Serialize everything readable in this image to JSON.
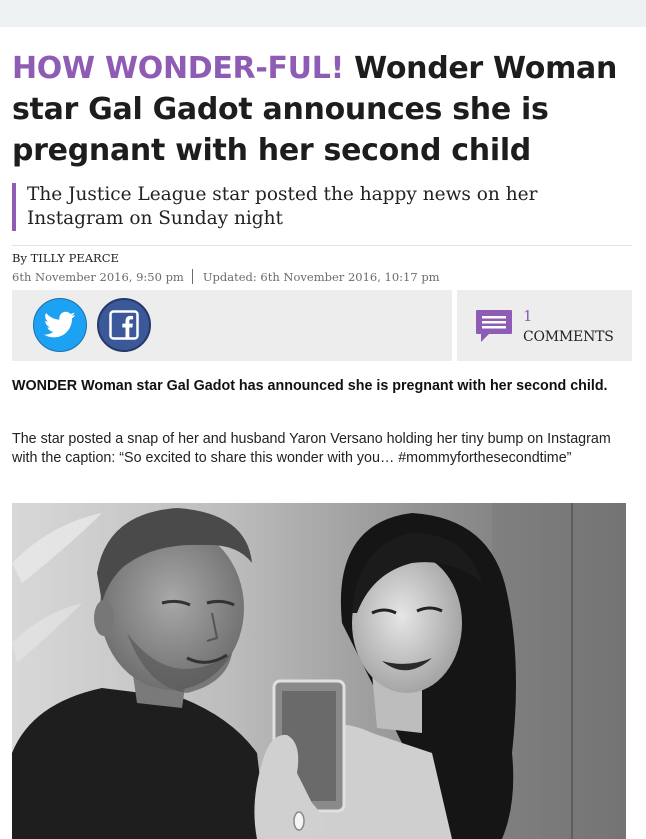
{
  "headline": {
    "kicker": "HOW WONDER-FUL!",
    "text": "Wonder Woman star Gal Gadot announces she is pregnant with her second child"
  },
  "standfirst": "The Justice League star posted the happy news on her Instagram on Sunday night",
  "byline": "By TILLY PEARCE",
  "published": "6th November 2016, 9:50 pm",
  "updated": "Updated: 6th November 2016, 10:17 pm",
  "share": {
    "twitter_icon": "twitter-icon",
    "facebook_icon": "facebook-icon"
  },
  "comments": {
    "count": "1",
    "label": "COMMENTS",
    "icon": "comment-icon"
  },
  "body": {
    "p1": "WONDER Woman star Gal Gadot has announced she is pregnant with her second child.",
    "p2": "The star posted a snap of her and husband Yaron Versano holding her tiny bump on Instagram with the caption: “So excited to share this wonder with you… #mommyforthesecondtime”"
  },
  "colors": {
    "accent": "#8e5bb5",
    "twitter": "#1da1f2",
    "facebook": "#3b5998"
  }
}
